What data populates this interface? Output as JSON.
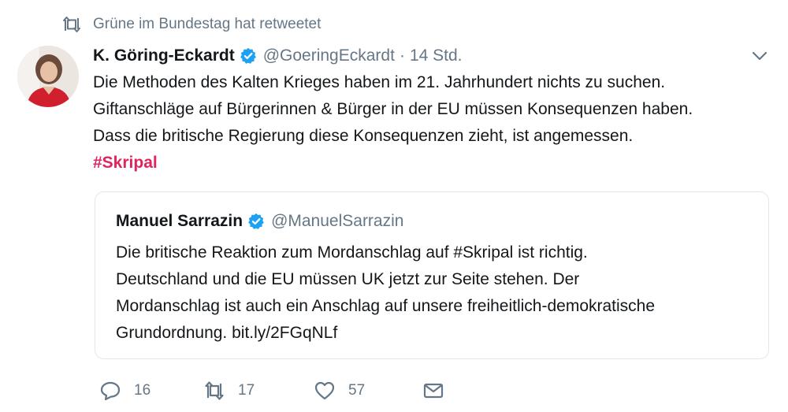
{
  "retweet_context": {
    "text": "Grüne im Bundestag hat retweetet"
  },
  "tweet": {
    "author_name": "K. Göring-Eckardt",
    "handle": "@GoeringEckardt",
    "separator": "·",
    "time": "14 Std.",
    "lines": [
      "Die Methoden des Kalten Krieges haben im 21. Jahrhundert nichts zu suchen.",
      "Giftanschläge auf Bürgerinnen & Bürger in der EU müssen Konsequenzen haben.",
      "Dass die britische Regierung diese Konsequenzen zieht, ist angemessen."
    ],
    "hashtag": "#Skripal"
  },
  "quoted_tweet": {
    "author_name": "Manuel Sarrazin",
    "handle": "@ManuelSarrazin",
    "lines": [
      "Die britische Reaktion zum Mordanschlag auf #Skripal ist richtig.",
      "Deutschland und die EU müssen UK jetzt zur Seite stehen. Der",
      "Mordanschlag ist auch ein Anschlag auf unsere freiheitlich-demokratische",
      "Grundordnung. bit.ly/2FGqNLf"
    ]
  },
  "actions": {
    "replies": "16",
    "retweets": "17",
    "likes": "57"
  },
  "colors": {
    "verified": "#1da1f2",
    "hashtag": "#e0245e",
    "secondary_text": "#657786"
  }
}
